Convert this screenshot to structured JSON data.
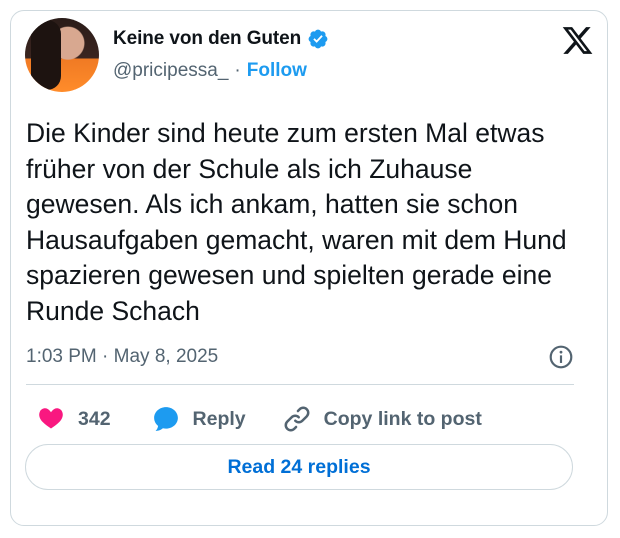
{
  "tweet": {
    "author": {
      "display_name": "Keine von den Guten",
      "handle": "@pricipessa_",
      "separator": "·",
      "follow_label": "Follow",
      "verified_icon": "verified-badge-icon"
    },
    "text": "Die Kinder sind heute zum ersten Mal etwas früher von der Schule als ich Zuhause gewesen. Als ich ankam, hatten sie schon Hausaufgaben gemacht, waren mit dem Hund spazieren gewesen und spielten gerade eine Runde Schach",
    "timestamp": "1:03 PM · May 8, 2025",
    "actions": {
      "like_count": "342",
      "reply_label": "Reply",
      "copy_link_label": "Copy link to post"
    },
    "read_replies_label": "Read 24 replies"
  },
  "colors": {
    "accent": "#1d9bf0",
    "like": "#f91880",
    "text_primary": "#0f1419",
    "text_secondary": "#536471",
    "border": "#cfd9de"
  }
}
